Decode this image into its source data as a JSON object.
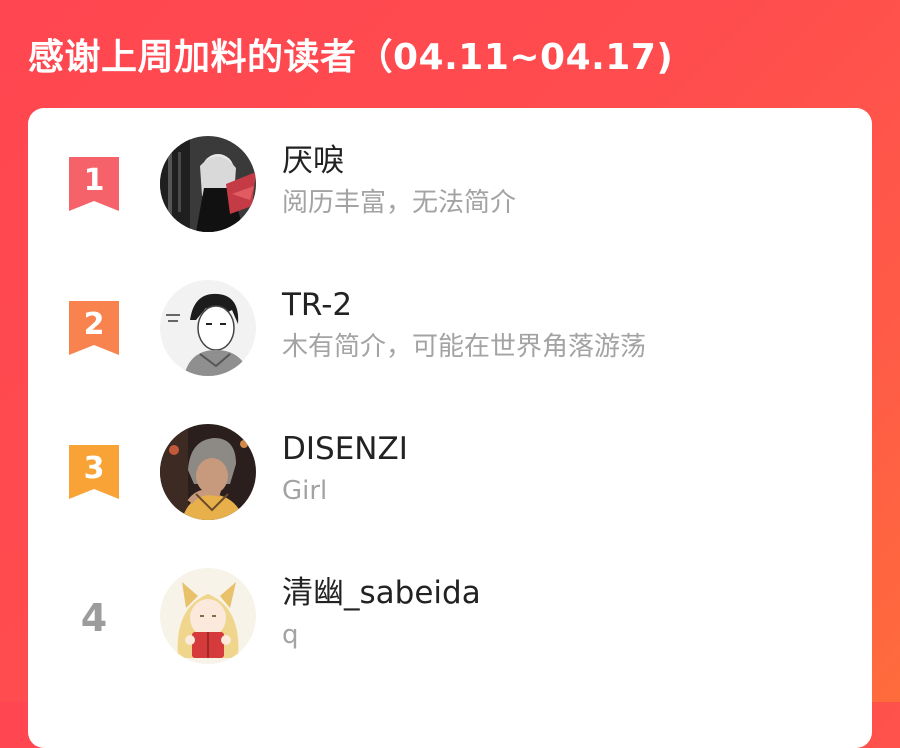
{
  "banner": {
    "title": "感谢上周加料的读者（04.11~04.17)"
  },
  "colors": {
    "background": "#ff4b4f",
    "rank_1": "#f5626a",
    "rank_2": "#f9834f",
    "rank_3": "#f9a236",
    "rank_other": "#9c9c9c",
    "name_text": "#222222",
    "bio_text": "#a3a3a3"
  },
  "readers": [
    {
      "rank": "1",
      "name": "厌唳",
      "bio": "阅历丰富，无法简介",
      "badge": "ribbon-bookmark-icon"
    },
    {
      "rank": "2",
      "name": "TR-2",
      "bio": "木有简介，可能在世界角落游荡",
      "badge": "ribbon-bookmark-icon"
    },
    {
      "rank": "3",
      "name": "DISENZI",
      "bio": "Girl",
      "badge": "ribbon-bookmark-icon"
    },
    {
      "rank": "4",
      "name": "清幽_sabeida",
      "bio": "q"
    }
  ]
}
